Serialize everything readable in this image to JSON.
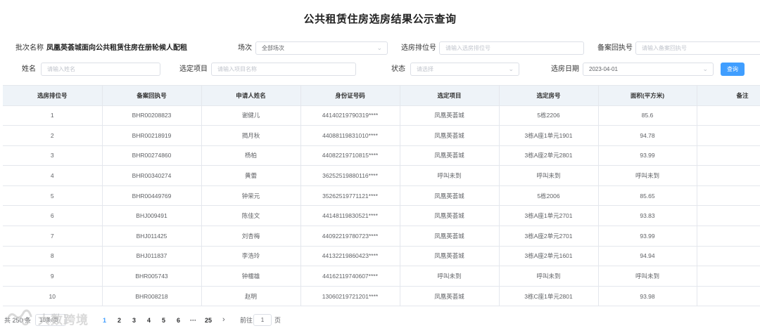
{
  "title": "公共租赁住房选房结果公示查询",
  "filters": {
    "batch_label": "批次名称",
    "batch_value": "凤凰英荟城面向公共租赁住房在册轮候人配租",
    "session_label": "场次",
    "session_value": "全部场次",
    "queue_label": "选房排位号",
    "queue_placeholder": "请输入选房排位号",
    "receipt_label": "备案回执号",
    "receipt_placeholder": "请输入备案回执号",
    "name_label": "姓名",
    "name_placeholder": "请输入姓名",
    "project_label": "选定项目",
    "project_placeholder": "请输入项目名称",
    "status_label": "状态",
    "status_placeholder": "请选择",
    "date_label": "选房日期",
    "date_value": "2023-04-01",
    "query_label": "查询"
  },
  "table": {
    "headers": [
      "选房排位号",
      "备案回执号",
      "申请人姓名",
      "身份证号码",
      "选定项目",
      "选定房号",
      "面积(平方米)",
      "备注"
    ],
    "rows": [
      [
        "1",
        "BHR00208823",
        "谢健儿",
        "44140219790319****",
        "凤凰英荟城",
        "5栋2206",
        "85.6",
        ""
      ],
      [
        "2",
        "BHR00218919",
        "揭月秋",
        "44088119831010****",
        "凤凰英荟城",
        "3栋A座1单元1901",
        "94.78",
        ""
      ],
      [
        "3",
        "BHR00274860",
        "杨柏",
        "44082219710815****",
        "凤凰英荟城",
        "3栋A座2单元2801",
        "93.99",
        ""
      ],
      [
        "4",
        "BHR00340274",
        "黄蕾",
        "36252519880116****",
        "呼叫未到",
        "呼叫未到",
        "呼叫未到",
        ""
      ],
      [
        "5",
        "BHR00449769",
        "钟荣元",
        "35262519771121****",
        "凤凰英荟城",
        "5栋2006",
        "85.65",
        ""
      ],
      [
        "6",
        "BHJ009491",
        "陈佳文",
        "44148119830521****",
        "凤凰英荟城",
        "3栋A座1单元2701",
        "93.83",
        ""
      ],
      [
        "7",
        "BHJ011425",
        "刘杏梅",
        "44092219780723****",
        "凤凰英荟城",
        "3栋A座2单元2701",
        "93.99",
        ""
      ],
      [
        "8",
        "BHJ011837",
        "李浩玲",
        "44132219860423****",
        "凤凰英荟城",
        "3栋A座2单元1601",
        "94.94",
        ""
      ],
      [
        "9",
        "BHR005743",
        "钟檑雄",
        "44162119740607****",
        "呼叫未到",
        "呼叫未到",
        "呼叫未到",
        ""
      ],
      [
        "10",
        "BHR008218",
        "赵明",
        "13060219721201****",
        "凤凰英荟城",
        "3栋C座1单元2801",
        "93.98",
        ""
      ]
    ]
  },
  "pagination": {
    "total": "共 250 条",
    "page_size": "10条/页",
    "pages": [
      "1",
      "2",
      "3",
      "4",
      "5",
      "6",
      "···",
      "25"
    ],
    "active_page": "1",
    "next_icon": "›",
    "goto_prefix": "前往",
    "goto_value": "1",
    "goto_suffix": "页"
  },
  "watermark": "大数跨境",
  "colors": {
    "primary": "#409eff",
    "header_bg": "#eef3f8",
    "border": "#e4e7ed"
  },
  "icons": {
    "select_chevron": "chevron-down-icon",
    "next_page": "chevron-right-icon"
  }
}
